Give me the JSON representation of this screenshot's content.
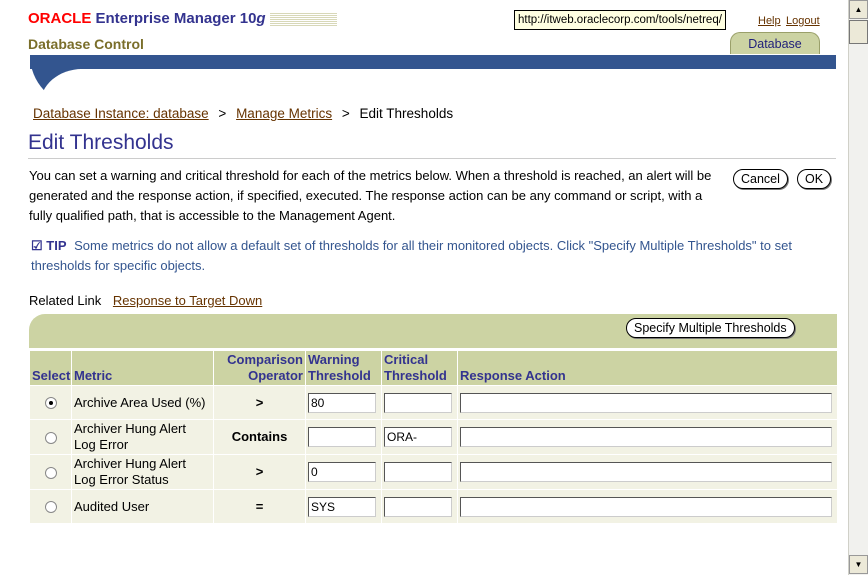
{
  "header": {
    "brand": "ORACLE",
    "product": "Enterprise Manager 10",
    "product_suffix": "g",
    "subtitle": "Database Control",
    "tooltip_url": "http://itweb.oraclecorp.com/tools/netreq/",
    "help_label": "Help",
    "logout_label": "Logout",
    "tab_label": "Database"
  },
  "breadcrumb": {
    "items": [
      "Database Instance: database",
      "Manage Metrics"
    ],
    "current": "Edit Thresholds",
    "separator": ">"
  },
  "page": {
    "title": "Edit Thresholds",
    "description": "You can set a warning and critical threshold for each of the metrics below. When a threshold is reached, an alert will be generated and the response action, if specified, executed. The response action can be any command or script, with a fully qualified path, that is accessible to the Management Agent.",
    "cancel_label": "Cancel",
    "ok_label": "OK",
    "tip_label": "TIP",
    "tip_text": "Some metrics do not allow a default set of thresholds for all their monitored objects. Click \"Specify Multiple Thresholds\" to set thresholds for specific objects.",
    "related_label": "Related Link",
    "related_link": "Response to Target Down",
    "specify_button": "Specify Multiple Thresholds"
  },
  "table": {
    "headers": {
      "select": "Select",
      "metric": "Metric",
      "comparison": "Comparison Operator",
      "warning": "Warning Threshold",
      "critical": "Critical Threshold",
      "response": "Response Action"
    },
    "rows": [
      {
        "metric": "Archive Area Used (%)",
        "operator": ">",
        "warning": "80",
        "critical": "",
        "response": "",
        "selected": true
      },
      {
        "metric": "Archiver Hung Alert Log Error",
        "operator": "Contains",
        "warning": "",
        "critical": "ORA-",
        "response": "",
        "selected": false
      },
      {
        "metric": "Archiver Hung Alert Log Error Status",
        "operator": ">",
        "warning": "0",
        "critical": "",
        "response": "",
        "selected": false
      },
      {
        "metric": "Audited User",
        "operator": "=",
        "warning": "SYS",
        "critical": "",
        "response": "",
        "selected": false
      }
    ]
  },
  "colors": {
    "brand_red": "#ff0000",
    "title_blue": "#33338f",
    "bar_blue": "#33558f",
    "header_khaki": "#ccd3a3",
    "link_brown": "#663300"
  },
  "icons": {
    "tip": "check-circle-icon",
    "scroll_up": "arrow-up-icon",
    "scroll_down": "arrow-down-icon"
  }
}
